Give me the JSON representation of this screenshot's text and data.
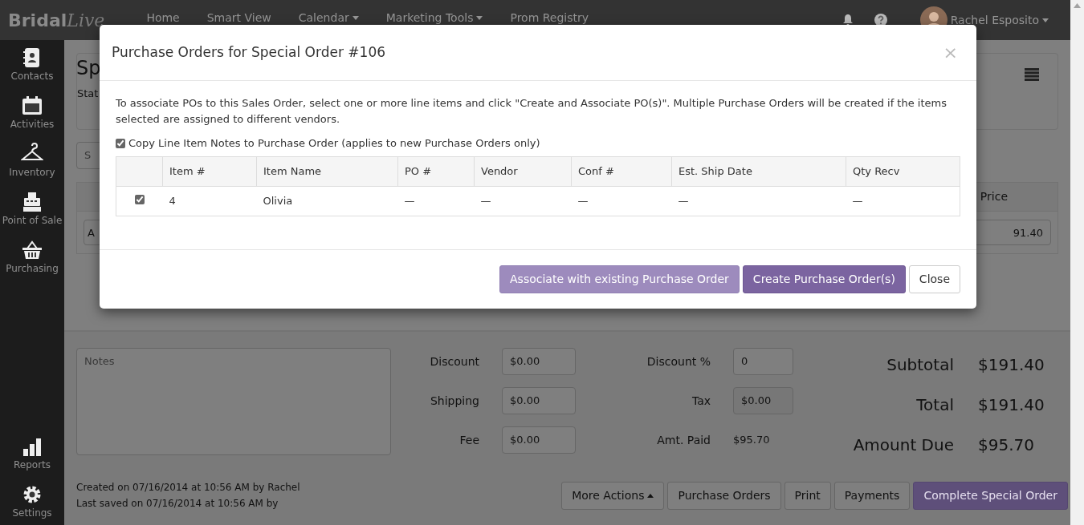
{
  "navbar": {
    "brand": [
      "Bridal",
      "Live"
    ],
    "links": [
      {
        "label": "Home",
        "dropdown": false
      },
      {
        "label": "Smart View",
        "dropdown": false
      },
      {
        "label": "Calendar",
        "dropdown": true
      },
      {
        "label": "Marketing Tools",
        "dropdown": true
      },
      {
        "label": "Prom Registry",
        "dropdown": false
      }
    ],
    "user": {
      "name": "Rachel Esposito",
      "dropdown": true
    }
  },
  "sidebar": {
    "items": [
      {
        "label": "Contacts",
        "kind": "contacts"
      },
      {
        "label": "Activities",
        "kind": "calendar"
      },
      {
        "label": "Inventory",
        "kind": "hanger"
      },
      {
        "label": "Point of Sale",
        "kind": "register"
      },
      {
        "label": "Purchasing",
        "kind": "basket"
      }
    ],
    "bottom_items": [
      {
        "label": "Reports",
        "kind": "chart"
      },
      {
        "label": "Settings",
        "kind": "gear"
      }
    ]
  },
  "page": {
    "title": "Sp",
    "status": "Stat",
    "search": {
      "placeholder": "S"
    },
    "line_items": {
      "columns": [
        "Price"
      ],
      "rows": [
        {
          "field": "A",
          "price": "91.40"
        }
      ]
    },
    "notes": {
      "placeholder": "Notes"
    },
    "adjustments": [
      {
        "label": "Discount",
        "value": "$0.00",
        "kind": "field"
      },
      {
        "label": "Discount %",
        "value": "0",
        "kind": "field"
      },
      {
        "label": "Shipping",
        "value": "$0.00",
        "kind": "field"
      },
      {
        "label": "Tax",
        "value": "$0.00",
        "kind": "readonly"
      },
      {
        "label": "Fee",
        "value": "$0.00",
        "kind": "field"
      },
      {
        "label": "Amt. Paid",
        "value": "$95.70",
        "kind": "text"
      }
    ],
    "totals": [
      {
        "label": "Subtotal",
        "value": "$191.40"
      },
      {
        "label": "Total",
        "value": "$191.40"
      },
      {
        "label": "Amount Due",
        "value": "$95.70"
      }
    ],
    "audit": [
      "Created on 07/16/2014 at 10:56 AM by Rachel",
      "Last saved on 07/16/2014 at 10:56 AM by"
    ],
    "actions": [
      {
        "label": "More Actions",
        "dropdown": true,
        "primary": false
      },
      {
        "label": "Purchase Orders",
        "dropdown": false,
        "primary": false
      },
      {
        "label": "Print",
        "dropdown": false,
        "primary": false
      },
      {
        "label": "Payments",
        "dropdown": false,
        "primary": false
      },
      {
        "label": "Complete Special Order",
        "dropdown": false,
        "primary": true
      }
    ]
  },
  "modal": {
    "title": "Purchase Orders for Special Order #106",
    "close": "×",
    "instructions": "To associate POs to this Sales Order, select one or more line items and click \"Create and Associate PO(s)\". Multiple Purchase Orders will be created if the items selected are assigned to different vendors.",
    "copy_notes": {
      "label": "Copy Line Item Notes to Purchase Order (applies to new Purchase Orders only)",
      "checked": true
    },
    "table": {
      "columns": [
        "Item #",
        "Item Name",
        "PO #",
        "Vendor",
        "Conf #",
        "Est. Ship Date",
        "Qty Recv"
      ],
      "rows": [
        {
          "checked": true,
          "cells": [
            "4",
            "Olivia",
            "—",
            "—",
            "—",
            "—",
            "—"
          ]
        }
      ]
    },
    "buttons": [
      {
        "label": "Associate with existing Purchase Order",
        "kind": "secondary"
      },
      {
        "label": "Create Purchase Order(s)",
        "kind": "primary"
      },
      {
        "label": "Close",
        "kind": "default"
      }
    ]
  }
}
